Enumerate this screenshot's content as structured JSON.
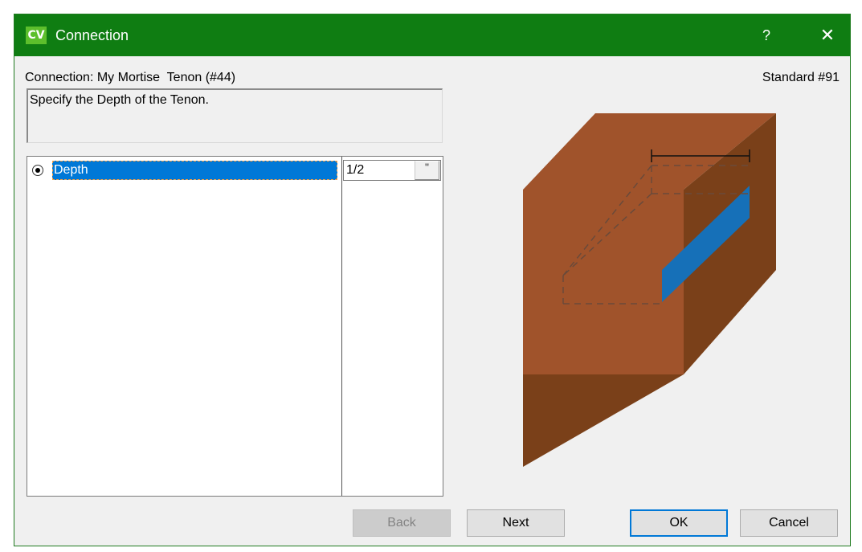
{
  "window": {
    "icon_text": "CV",
    "title": "Connection",
    "help_glyph": "?",
    "close_glyph": "✕"
  },
  "header": {
    "connection_label": "Connection: My Mortise  Tenon (#44)",
    "standard_label": "Standard #91"
  },
  "description": "Specify the Depth of the Tenon.",
  "parameters": [
    {
      "name": "Depth",
      "value": "1/2",
      "selected": true,
      "button_glyph": "\""
    }
  ],
  "buttons": {
    "back": "Back",
    "next": "Next",
    "ok": "OK",
    "cancel": "Cancel"
  },
  "colors": {
    "titlebar": "#0f7d12",
    "selection": "#0078d7",
    "wood_top": "#a0532b",
    "wood_side": "#7a4019",
    "tenon_slot": "#1670b8"
  }
}
